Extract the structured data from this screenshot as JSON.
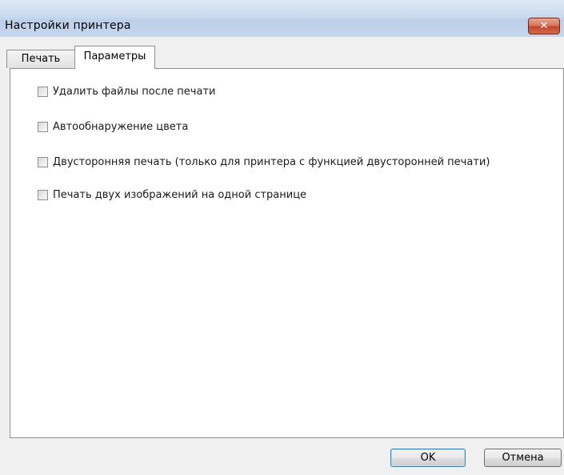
{
  "window": {
    "title": "Настройки принтера",
    "close_glyph": "✕"
  },
  "tabs": [
    {
      "label": "Печать",
      "selected": false
    },
    {
      "label": "Параметры",
      "selected": true
    }
  ],
  "options": [
    {
      "label": "Удалить файлы после печати",
      "checked": false
    },
    {
      "label": "Автообнаружение цвета",
      "checked": false
    },
    {
      "label": "Двусторонняя печать (только для принтера с функцией двусторонней печати)",
      "checked": false
    },
    {
      "label": "Печать двух изображений на одной странице",
      "checked": false
    }
  ],
  "buttons": {
    "ok_label": "OK",
    "cancel_label": "Отмена"
  },
  "colors": {
    "close_button": "#c7462a",
    "default_button_border": "#3c7fb1"
  }
}
